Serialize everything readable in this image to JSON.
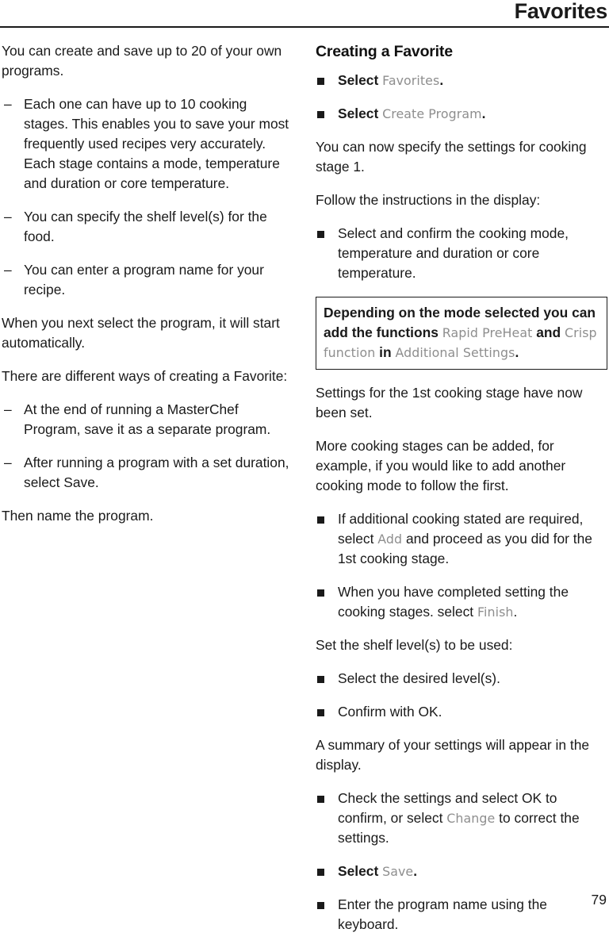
{
  "header": {
    "title": "Favorites"
  },
  "footer": {
    "page_number": "79"
  },
  "left_column": {
    "intro": "You can create and save up to 20 of your own programs.",
    "dash_items": [
      {
        "marker": "–",
        "text": "Each one can have up to 10 cooking stages. This enables you to save your most frequently used recipes very accurately. Each stage contains a mode, temperature and duration or core temperature."
      },
      {
        "marker": "–",
        "text": "You can specify the shelf level(s) for the food."
      },
      {
        "marker": "–",
        "text": "You can enter a program name for your recipe."
      }
    ],
    "para_auto_start": "When you next select the program, it will start automatically.",
    "para_ways": "There are different ways of creating a Favorite:",
    "dash_items_2": [
      {
        "marker": "–",
        "text": "At the end of running a MasterChef Program, save it as a separate program."
      },
      {
        "marker": "–",
        "text": "After running a program with a set duration, select Save."
      }
    ],
    "para_then_name": "Then name the program."
  },
  "right_column": {
    "section_title": "Creating a Favorite",
    "bullet_select_favorites": {
      "lead": "Select ",
      "term": "Favorites",
      "tail": "."
    },
    "bullet_select_create_program": {
      "lead": "Select ",
      "term": "Create Program",
      "tail": "."
    },
    "para_specify_stage1": "You can now specify the settings for cooking stage 1.",
    "para_follow_instructions": "Follow the instructions in the display:",
    "bullet_select_confirm": "Select and confirm the cooking mode, temperature and duration or core temperature.",
    "note_box": {
      "part1": "Depending on the mode selected you can add the functions ",
      "term1": "Rapid PreHeat",
      "part2": " and ",
      "term2": "Crisp function",
      "part3": " in ",
      "term3": "Additional Settings",
      "part4": "."
    },
    "para_stage1_set": "Settings for the 1st cooking stage have now been set.",
    "para_more_stages": "More cooking stages can be added, for example, if you would like to add another cooking mode to follow the first.",
    "bullet_additional_stages": {
      "part1": "If additional cooking stated are required, select ",
      "term": "Add",
      "part2": " and proceed as you did for the 1st cooking stage."
    },
    "bullet_finish": {
      "part1": "When you have completed setting the cooking stages. select ",
      "term": "Finish",
      "part2": "."
    },
    "para_set_shelf": "Set the shelf level(s) to be used:",
    "bullet_desired_level": "Select the desired level(s).",
    "bullet_confirm_ok": "Confirm with OK.",
    "para_summary": "A summary of your settings will appear in the display.",
    "bullet_check_settings": {
      "part1": "Check the settings and select OK to confirm, or select ",
      "term": "Change",
      "part2": " to correct the settings."
    },
    "bullet_select_save": {
      "lead": "Select ",
      "term": "Save",
      "tail": "."
    },
    "bullet_enter_name": "Enter the program name using the keyboard."
  }
}
